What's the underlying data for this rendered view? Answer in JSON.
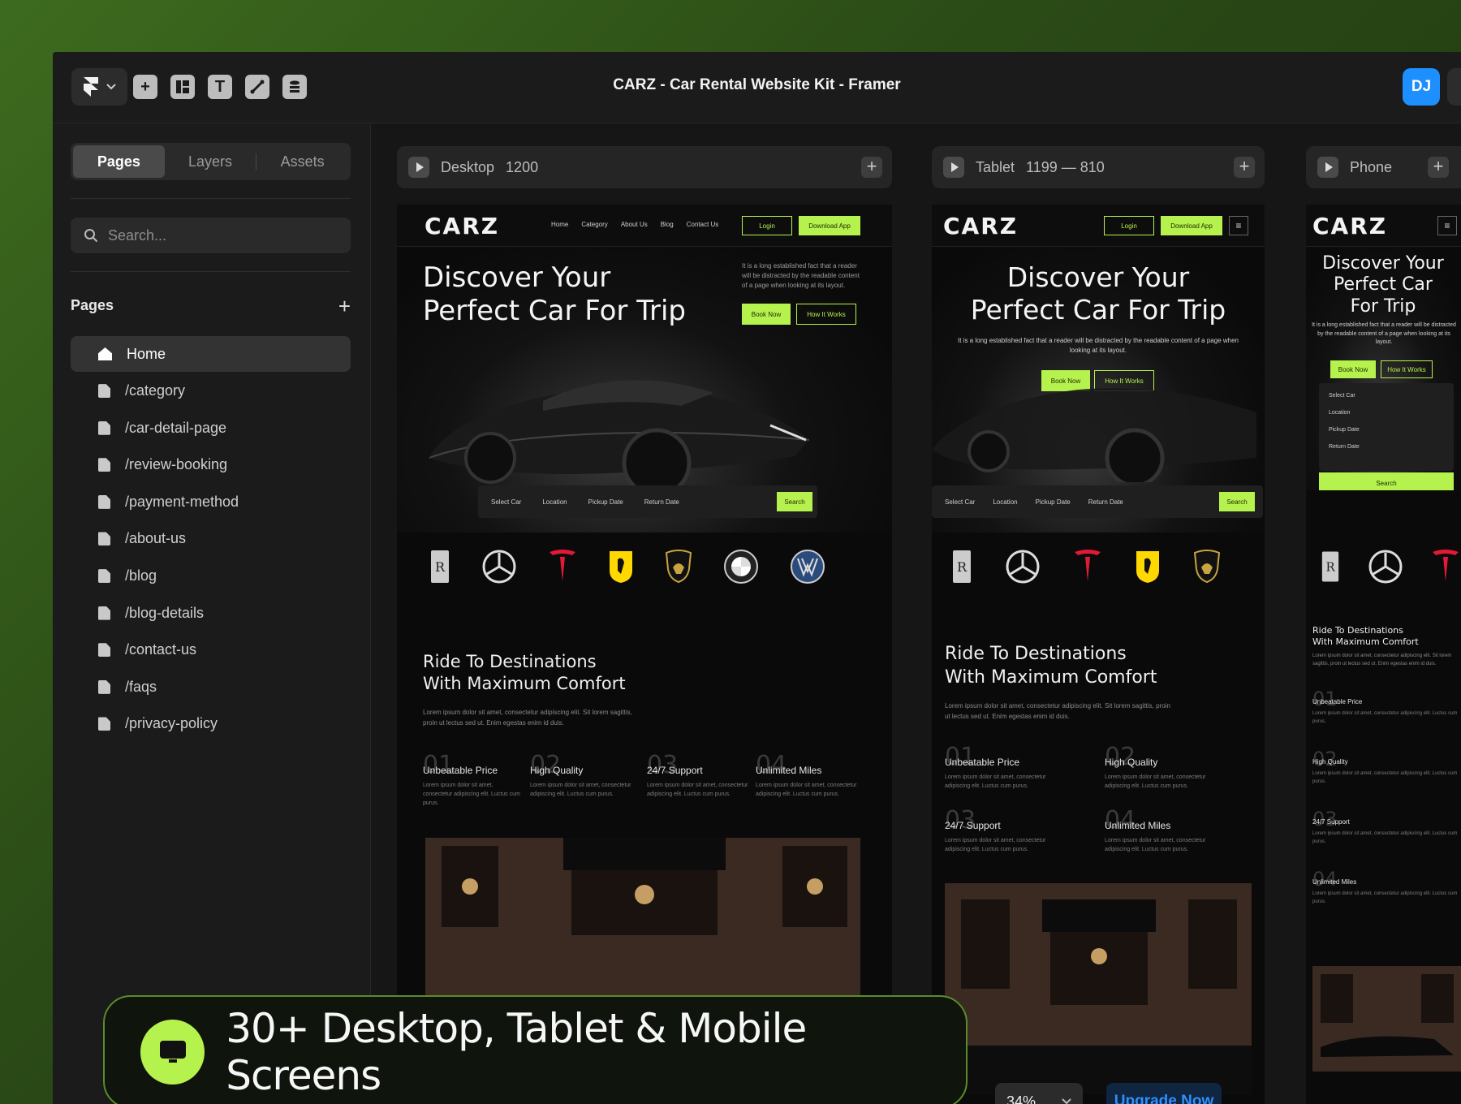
{
  "window": {
    "title": "CARZ - Car Rental Website Kit - Framer",
    "avatar_initials": "DJ"
  },
  "toolbar": {
    "tools": [
      "insert-icon",
      "layout-icon",
      "text-icon",
      "vector-icon",
      "cms-icon"
    ]
  },
  "sidebar": {
    "tabs": [
      "Pages",
      "Layers",
      "Assets"
    ],
    "active_tab": "Pages",
    "search_placeholder": "Search...",
    "section_title": "Pages",
    "pages": [
      "Home",
      "/category",
      "/car-detail-page",
      "/review-booking",
      "/payment-method",
      "/about-us",
      "/blog",
      "/blog-details",
      "/contact-us",
      "/faqs",
      "/privacy-policy"
    ]
  },
  "frames": {
    "desktop": {
      "label": "Desktop",
      "size": "1200"
    },
    "tablet": {
      "label": "Tablet",
      "size": "1199 — 810"
    },
    "phone": {
      "label": "Phone"
    }
  },
  "site": {
    "brand": "CARZ",
    "nav": [
      "Home",
      "Category",
      "About Us",
      "Blog",
      "Contact Us"
    ],
    "login": "Login",
    "download": "Download App",
    "hero_line1": "Discover Your",
    "hero_line2": "Perfect Car For Trip",
    "phone_hero_1": "Discover Your",
    "phone_hero_2": "Perfect Car",
    "phone_hero_3": "For Trip",
    "hero_desc": "It is a long established fact that a reader will be distracted by the readable content of a page when looking at its layout.",
    "book_now": "Book Now",
    "how_it_works": "How It Works",
    "search_fields": [
      "Select Car",
      "Location",
      "Pickup Date",
      "Return Date"
    ],
    "search_btn": "Search",
    "section_title_1": "Ride To Destinations",
    "section_title_2": "With Maximum Comfort",
    "section_desc": "Lorem ipsum dolor sit amet, consectetur adipiscing elit. Sit lorem sagittis, proin ut lectus sed ut. Enim egestas enim id duis.",
    "features": [
      {
        "num": "01",
        "title": "Unbeatable Price",
        "desc": "Lorem ipsum dolor sit amet, consectetur adipiscing elit. Luctus cum purus."
      },
      {
        "num": "02",
        "title": "High Quality",
        "desc": "Lorem ipsum dolor sit amet, consectetur adipiscing elit. Luctus cum purus."
      },
      {
        "num": "03",
        "title": "24/7 Support",
        "desc": "Lorem ipsum dolor sit amet, consectetur adipiscing elit. Luctus cum purus."
      },
      {
        "num": "04",
        "title": "Unlimited Miles",
        "desc": "Lorem ipsum dolor sit amet, consectetur adipiscing elit. Luctus cum purus."
      }
    ],
    "brands": [
      "rolls-royce-logo",
      "mercedes-logo",
      "tesla-logo",
      "ferrari-logo",
      "lamborghini-logo",
      "bmw-logo",
      "volkswagen-logo"
    ]
  },
  "banner": {
    "text": "30+ Desktop, Tablet & Mobile Screens"
  },
  "bottom": {
    "zoom": "34%",
    "upgrade": "Upgrade Now"
  },
  "colors": {
    "accent": "#b6f24d",
    "avatar": "#1e8fff",
    "upgrade_text": "#2f8fff"
  }
}
